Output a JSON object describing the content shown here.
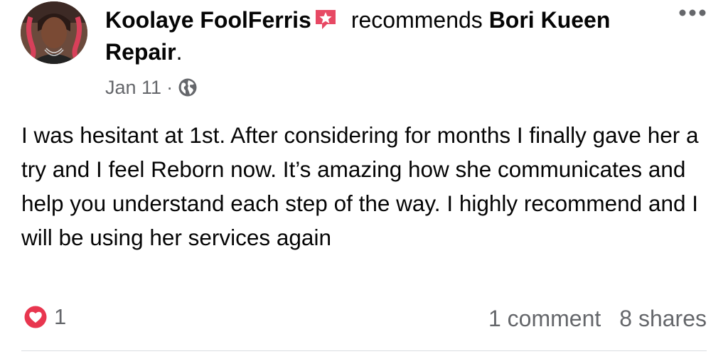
{
  "post": {
    "author": "Koolaye FoolFerris",
    "verb": "recommends",
    "business": "Bori Kueen Repair",
    "period": ".",
    "date": "Jan 11",
    "separator": "·",
    "privacy_icon": "globe-icon",
    "body": "I was hesitant at 1st. After considering for months I finally gave her a try and I feel Reborn now. It’s amazing how she communicates and help you understand each step of the way. I highly recommend and I will be using her services again"
  },
  "engagement": {
    "reaction_icon": "heart-icon",
    "reaction_count": "1",
    "comments": "1 comment",
    "shares": "8 shares"
  },
  "colors": {
    "recommend_badge": "#e74964",
    "heart_badge": "#e8364f",
    "secondary_text": "#65676b",
    "primary_text": "#050505"
  }
}
